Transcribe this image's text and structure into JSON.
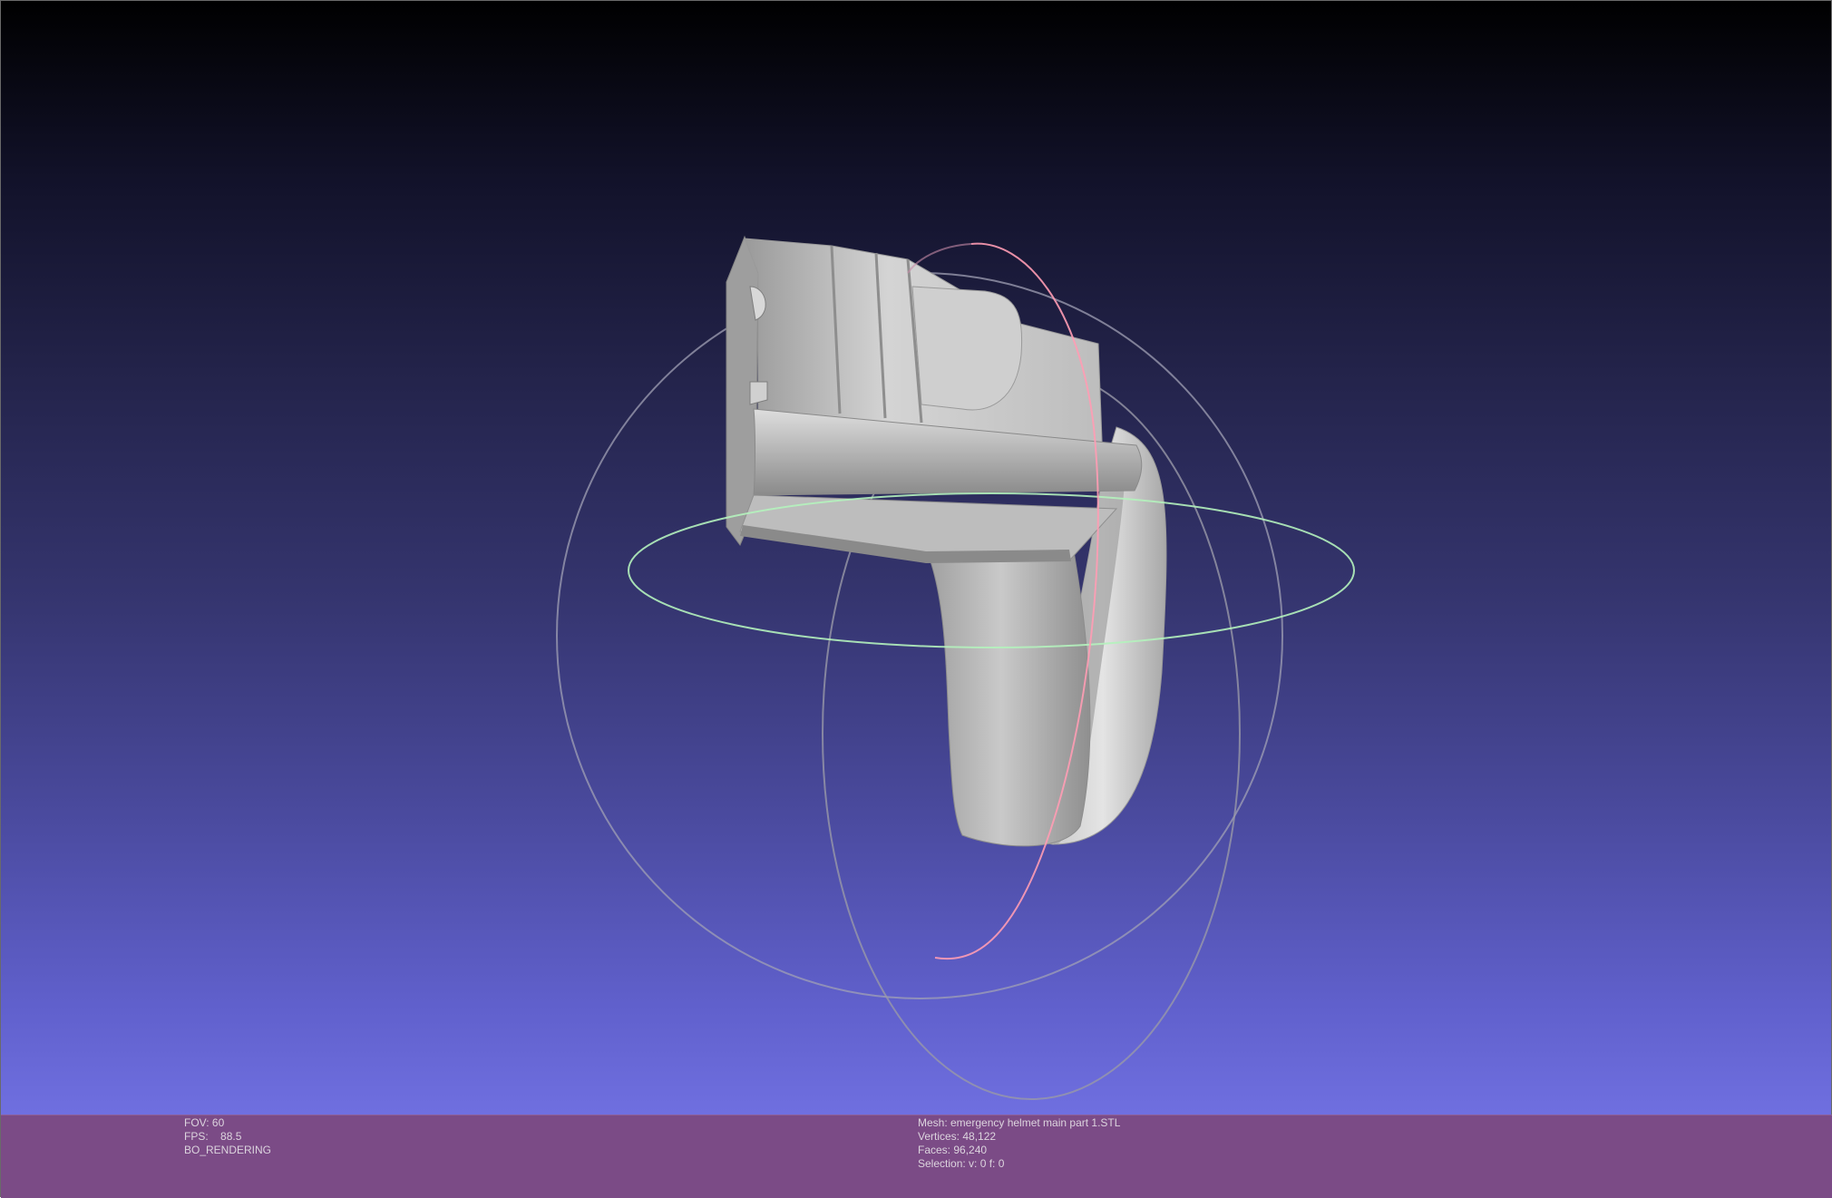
{
  "colors": {
    "background_top": "#000000",
    "background_bottom": "#7474e6",
    "status_bar": "#7b4b86",
    "status_text": "#dcd4de",
    "mesh": "#c8c8c8",
    "trackball_x": "#ff9cb4",
    "trackball_y": "#a8f0b0",
    "trackball_z": "#c8c8c8"
  },
  "viewport_info": {
    "fov_label": "FOV: 60",
    "fps_label": "FPS:",
    "fps_value": "88.5",
    "render_mode": "BO_RENDERING"
  },
  "mesh_info": {
    "mesh_label": "Mesh: emergency helmet main part 1.STL",
    "vertices_label": "Vertices: 48,122",
    "faces_label": "Faces: 96,240",
    "selection_label": "Selection: v: 0 f: 0"
  },
  "icons": {
    "trackball": "trackball-gizmo",
    "mesh": "3d-mesh-model"
  }
}
